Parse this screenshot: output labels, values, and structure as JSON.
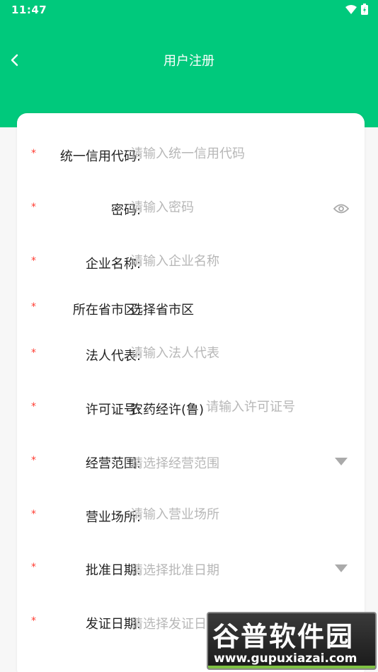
{
  "status": {
    "time": "11:47"
  },
  "nav": {
    "title": "用户注册"
  },
  "colors": {
    "brand": "#00c97c",
    "required": "#ff3b30",
    "placeholder": "#b7b7b7"
  },
  "form": {
    "required_mark": "*",
    "credit_code": {
      "label": "统一信用代码:",
      "placeholder": "请输入统一信用代码"
    },
    "password": {
      "label": "密码:",
      "placeholder": "请输入密码",
      "icon": "eye-icon"
    },
    "company_name": {
      "label": "企业名称:",
      "placeholder": "请输入企业名称"
    },
    "region": {
      "label": "所在省市区:",
      "value": "选择省市区"
    },
    "legal_rep": {
      "label": "法人代表:",
      "placeholder": "请输入法人代表"
    },
    "license_no": {
      "label": "许可证号:",
      "prefix": "农药经许(鲁)",
      "placeholder": "请输入许可证号"
    },
    "business_scope": {
      "label": "经营范围:",
      "placeholder": "请选择经营范围",
      "icon": "caret-down-icon"
    },
    "business_place": {
      "label": "营业场所:",
      "placeholder": "请输入营业场所"
    },
    "approval_date": {
      "label": "批准日期:",
      "placeholder": "请选择批准日期",
      "icon": "caret-down-icon"
    },
    "issue_date": {
      "label": "发证日期:",
      "placeholder": "请选择发证日期",
      "icon": "caret-down-icon"
    }
  },
  "watermark": {
    "brand": "谷普软件园",
    "url": "www.gupuxiazai.com"
  }
}
